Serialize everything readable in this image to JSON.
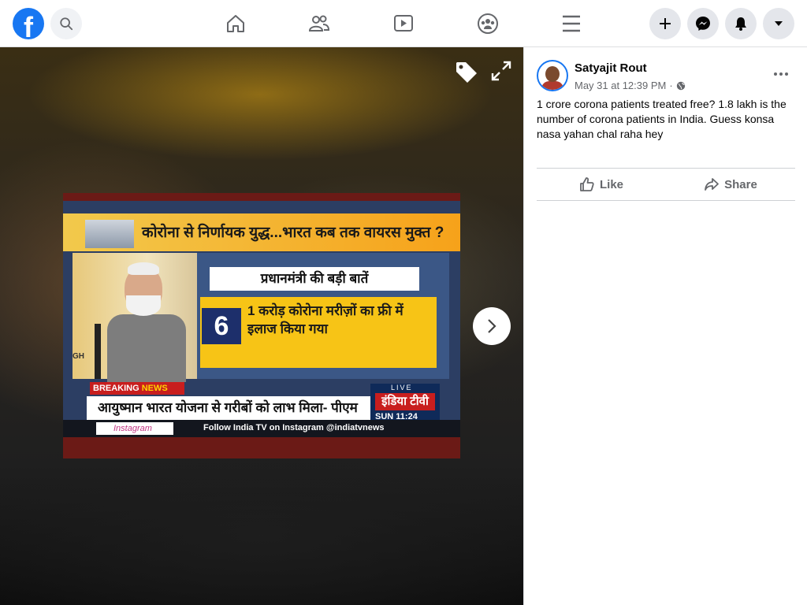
{
  "app": {
    "brand": "f",
    "accent": "#1877f2"
  },
  "nav": {
    "icons": [
      "home-icon",
      "friends-icon",
      "watch-icon",
      "groups-icon",
      "menu-icon"
    ],
    "right_buttons": [
      "create-icon",
      "messenger-icon",
      "notifications-icon",
      "account-icon"
    ]
  },
  "media": {
    "headline": "कोरोना से निर्णायक युद्ध...भारत कब तक वायरस मुक्त ?",
    "subtitle": "प्रधानमंत्री की बड़ी बातें",
    "number": "6",
    "point_text": "1 करोड़ कोरोना मरीज़ों का फ्री में इलाज किया गया",
    "breaking_label": "BREAKING",
    "breaking_label2": "NEWS",
    "ticker": "आयुष्मान भारत योजना से गरीबों को लाभ मिला- पीएम",
    "live": "LIVE",
    "channel": "इंडिया टीवी",
    "time": "SUN 11:24",
    "insta_label": "Instagram",
    "follow_text": "Follow India TV on Instagram @indiatvnews",
    "side_text": "GH"
  },
  "post": {
    "author": "Satyajit Rout",
    "timestamp": "May 31 at 12:39 PM",
    "separator": "·",
    "text": "1 crore corona patients treated free? 1.8 lakh is the number of corona patients in India. Guess konsa nasa yahan chal raha hey",
    "like_label": "Like",
    "share_label": "Share"
  }
}
